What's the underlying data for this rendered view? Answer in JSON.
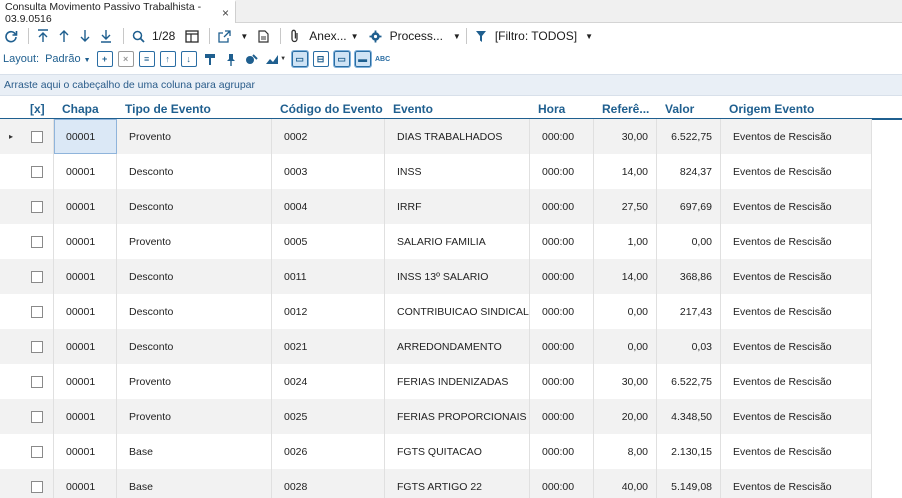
{
  "tab": {
    "title": "Consulta Movimento Passivo Trabalhista - 03.9.0516",
    "close_glyph": "×"
  },
  "toolbar": {
    "record_position": "1/28",
    "anexos_label": "Anex...",
    "processos_label": "Process...",
    "filter_label": "[Filtro: TODOS]"
  },
  "toolbar2": {
    "layout_label": "Layout:",
    "layout_value": "Padrão",
    "abc_label": "ABC"
  },
  "group_panel": {
    "hint": "Arraste aqui o cabeçalho de uma coluna para agrupar"
  },
  "colors": {
    "accent": "#1f5f8f",
    "row_alt": "#f2f2f2",
    "selection": "#dbe8f6"
  },
  "grid": {
    "columns": [
      {
        "key": "sel",
        "label": "[x]"
      },
      {
        "key": "chapa",
        "label": "Chapa"
      },
      {
        "key": "tipo",
        "label": "Tipo de Evento"
      },
      {
        "key": "codigo",
        "label": "Código do Evento"
      },
      {
        "key": "evento",
        "label": "Evento"
      },
      {
        "key": "hora",
        "label": "Hora"
      },
      {
        "key": "referencia",
        "label": "Referê..."
      },
      {
        "key": "valor",
        "label": "Valor"
      },
      {
        "key": "origem",
        "label": "Origem Evento"
      }
    ],
    "rows": [
      {
        "chapa": "00001",
        "tipo": "Provento",
        "codigo": "0002",
        "evento": "DIAS TRABALHADOS",
        "hora": "000:00",
        "referencia": "30,00",
        "valor": "6.522,75",
        "origem": "Eventos de Rescisão"
      },
      {
        "chapa": "00001",
        "tipo": "Desconto",
        "codigo": "0003",
        "evento": "INSS",
        "hora": "000:00",
        "referencia": "14,00",
        "valor": "824,37",
        "origem": "Eventos de Rescisão"
      },
      {
        "chapa": "00001",
        "tipo": "Desconto",
        "codigo": "0004",
        "evento": "IRRF",
        "hora": "000:00",
        "referencia": "27,50",
        "valor": "697,69",
        "origem": "Eventos de Rescisão"
      },
      {
        "chapa": "00001",
        "tipo": "Provento",
        "codigo": "0005",
        "evento": "SALARIO FAMILIA",
        "hora": "000:00",
        "referencia": "1,00",
        "valor": "0,00",
        "origem": "Eventos de Rescisão"
      },
      {
        "chapa": "00001",
        "tipo": "Desconto",
        "codigo": "0011",
        "evento": "INSS 13º SALARIO",
        "hora": "000:00",
        "referencia": "14,00",
        "valor": "368,86",
        "origem": "Eventos de Rescisão"
      },
      {
        "chapa": "00001",
        "tipo": "Desconto",
        "codigo": "0012",
        "evento": "CONTRIBUICAO SINDICAL",
        "hora": "000:00",
        "referencia": "0,00",
        "valor": "217,43",
        "origem": "Eventos de Rescisão"
      },
      {
        "chapa": "00001",
        "tipo": "Desconto",
        "codigo": "0021",
        "evento": "ARREDONDAMENTO",
        "hora": "000:00",
        "referencia": "0,00",
        "valor": "0,03",
        "origem": "Eventos de Rescisão"
      },
      {
        "chapa": "00001",
        "tipo": "Provento",
        "codigo": "0024",
        "evento": "FERIAS INDENIZADAS",
        "hora": "000:00",
        "referencia": "30,00",
        "valor": "6.522,75",
        "origem": "Eventos de Rescisão"
      },
      {
        "chapa": "00001",
        "tipo": "Provento",
        "codigo": "0025",
        "evento": "FERIAS PROPORCIONAIS",
        "hora": "000:00",
        "referencia": "20,00",
        "valor": "4.348,50",
        "origem": "Eventos de Rescisão"
      },
      {
        "chapa": "00001",
        "tipo": "Base",
        "codigo": "0026",
        "evento": "FGTS QUITACAO",
        "hora": "000:00",
        "referencia": "8,00",
        "valor": "2.130,15",
        "origem": "Eventos de Rescisão"
      },
      {
        "chapa": "00001",
        "tipo": "Base",
        "codigo": "0028",
        "evento": "FGTS ARTIGO 22",
        "hora": "000:00",
        "referencia": "40,00",
        "valor": "5.149,08",
        "origem": "Eventos de Rescisão"
      }
    ]
  }
}
